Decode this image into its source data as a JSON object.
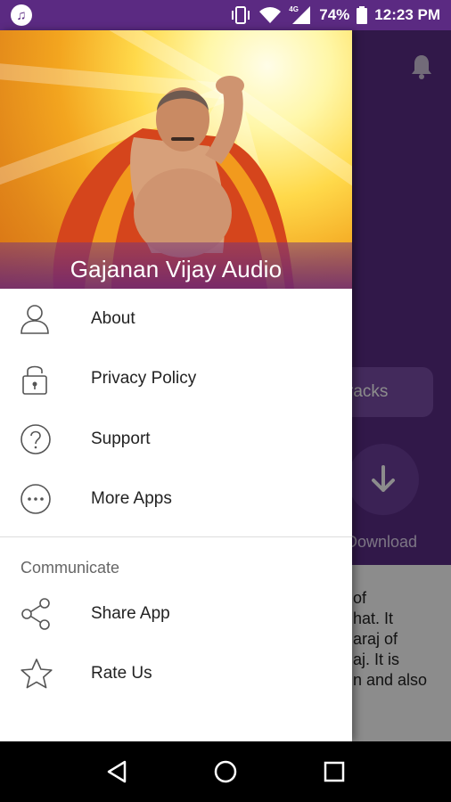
{
  "status_bar": {
    "battery": "74%",
    "time": "12:23 PM",
    "network": "4G"
  },
  "background": {
    "tracks_button": "racks",
    "download_label": "Download",
    "description": "of\nhat. It\naraj of\naj. It is\nn and also"
  },
  "drawer": {
    "header_title": "Gajanan Vijay Audio",
    "items": [
      {
        "label": "About",
        "icon": "person-icon"
      },
      {
        "label": "Privacy Policy",
        "icon": "lock-icon"
      },
      {
        "label": "Support",
        "icon": "help-icon"
      },
      {
        "label": "More Apps",
        "icon": "more-icon"
      }
    ],
    "section_title": "Communicate",
    "communicate_items": [
      {
        "label": "Share App",
        "icon": "share-icon"
      },
      {
        "label": "Rate Us",
        "icon": "star-icon"
      }
    ]
  },
  "colors": {
    "primary": "#5b2a82",
    "drawer_bg": "#ffffff",
    "icon_stroke": "#555555"
  }
}
